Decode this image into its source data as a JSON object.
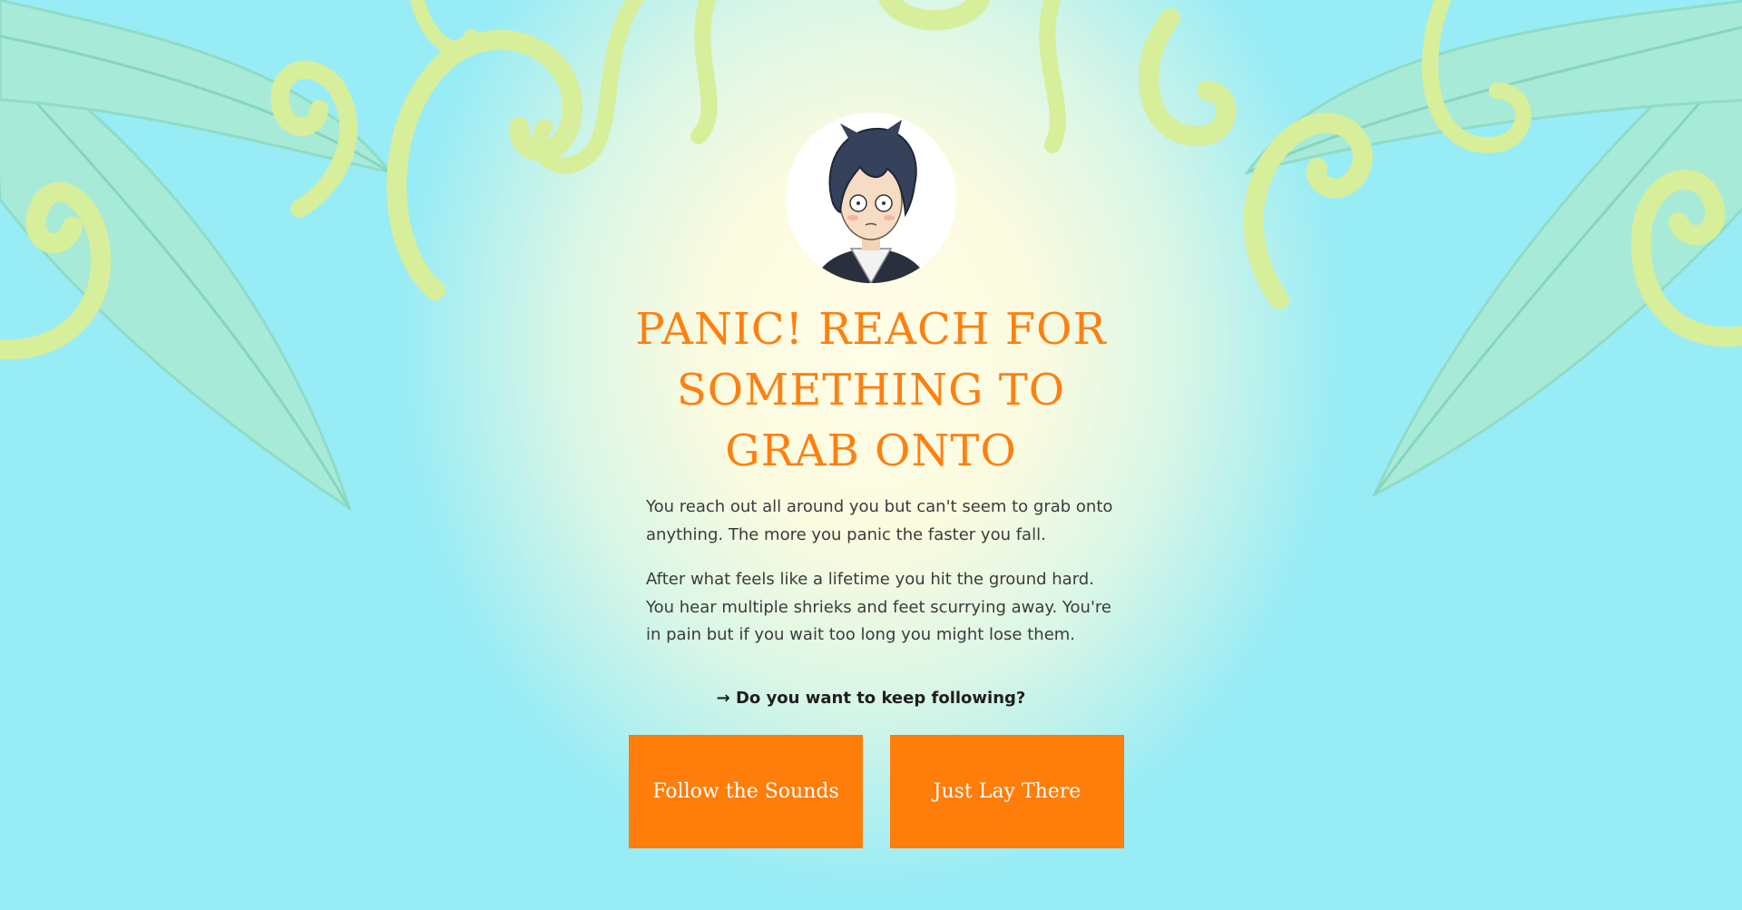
{
  "page": {
    "title": "Panic! Reach for something to grab onto",
    "paragraphs": [
      "You reach out all around you but can't seem to grab onto anything. The more you panic the faster you fall.",
      "After what feels like a lifetime you hit the ground hard. You hear multiple shrieks and feet scurrying away. You're in pain but if you wait too long you might lose them."
    ],
    "prompt": "→ Do you want to keep following?",
    "choices": [
      {
        "label": "Follow the Sounds"
      },
      {
        "label": "Just Lay There"
      }
    ]
  },
  "colors": {
    "accent": "#ff7f0f",
    "button_bg": "#ff7d0a",
    "button_text": "#ffffff",
    "leaf": "#9fe9d6",
    "vine": "#d9ee9c"
  },
  "icons": {
    "avatar": "character-portrait",
    "decor": [
      "leaf",
      "vine-swirl"
    ]
  }
}
